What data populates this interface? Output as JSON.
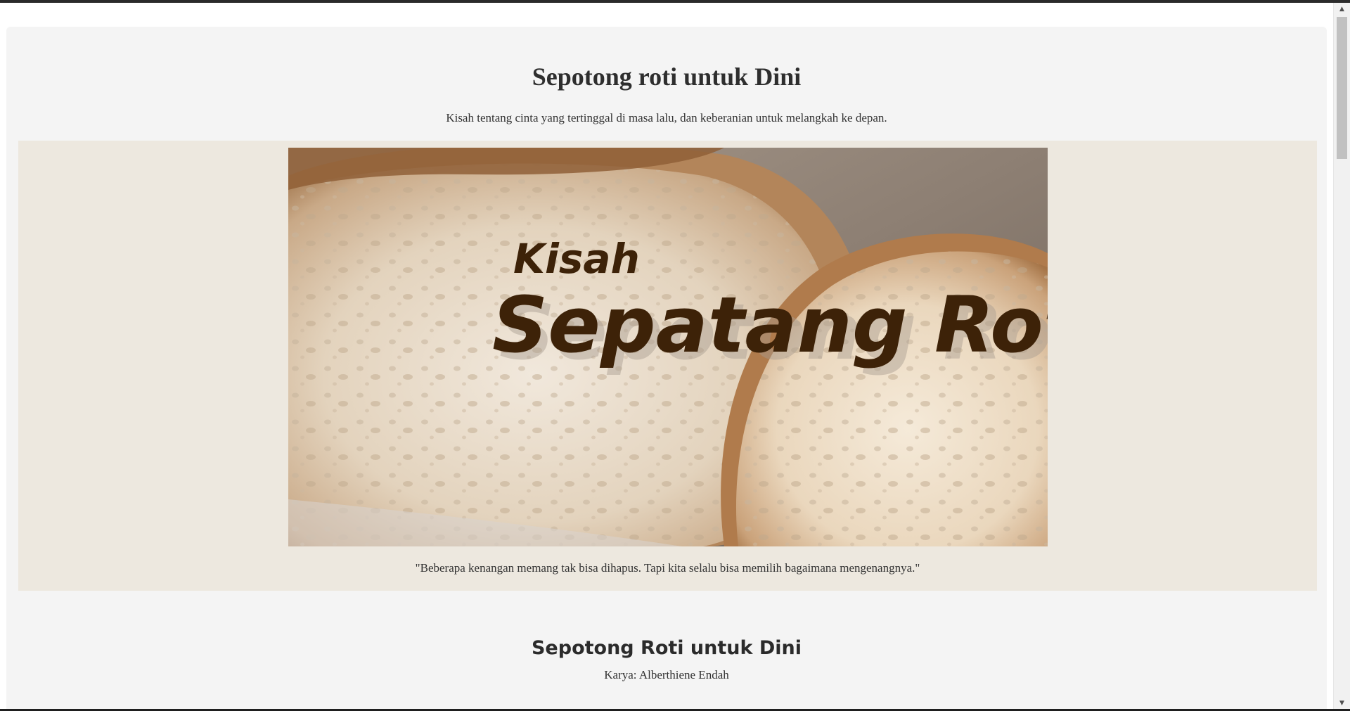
{
  "page": {
    "title": "Sepotong roti untuk Dini",
    "subtitle": "Kisah tentang cinta yang tertinggal di masa lalu, dan keberanian untuk melangkah ke depan."
  },
  "hero": {
    "image_text_small": "Kisah",
    "image_text_large": "Sepotong Roti",
    "quote": "\"Beberapa kenangan memang tak bisa dihapus. Tapi kita selalu bisa memilih bagaimana mengenangnya.\""
  },
  "book": {
    "title": "Sepotong Roti untuk Dini",
    "author": "Karya: Alberthiene Endah"
  },
  "scrollbar": {
    "up_icon": "▲",
    "down_icon": "▼"
  },
  "colors": {
    "page_background": "#f4f4f4",
    "hero_background": "#ede8df",
    "text": "#333333",
    "title_text": "#2e2e2e",
    "image_lettering": "#3d2208"
  }
}
